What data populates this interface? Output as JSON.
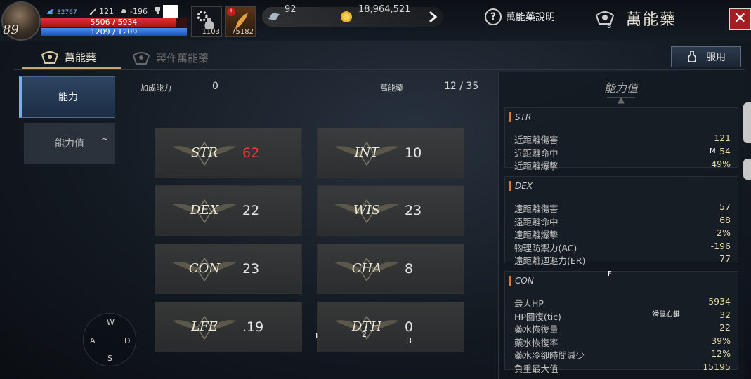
{
  "hud": {
    "level": "89",
    "exp": "32767",
    "attack": "121",
    "armor": "-196",
    "hp": "5506 / 5934",
    "hp_fraction": 0.928,
    "mp": "1209 / 1209",
    "mp_fraction": 1.0,
    "slot1_count": "1103",
    "slot2_count": "75182",
    "silver": "92",
    "gold": "18,964,521",
    "help_label": "萬能藥說明",
    "title": "萬能藥",
    "title_badge": "8",
    "close_label": "✕"
  },
  "tabs": [
    {
      "label": "萬能藥",
      "active": true
    },
    {
      "label": "製作萬能藥",
      "active": false
    }
  ],
  "use_button": "服用",
  "nav": {
    "items": [
      {
        "label": "能力"
      },
      {
        "label": "能力值"
      }
    ],
    "item2_marker": "~"
  },
  "compass": {
    "n": "W",
    "w": "A",
    "e": "D",
    "s": "S"
  },
  "summary": {
    "bonus_label": "加成能力",
    "bonus_value": "0",
    "potion_label": "萬能藥",
    "potion_value": "12 / 35"
  },
  "stats": [
    {
      "name": "STR",
      "value": "62"
    },
    {
      "name": "INT",
      "value": "10"
    },
    {
      "name": "DEX",
      "value": "22"
    },
    {
      "name": "WIS",
      "value": "23"
    },
    {
      "name": "CON",
      "value": "23"
    },
    {
      "name": "CHA",
      "value": "8"
    },
    {
      "name": "LFE",
      "value": ".19"
    },
    {
      "name": "DTH",
      "value": "0"
    }
  ],
  "markers": [
    "1",
    "2",
    "3"
  ],
  "panel": {
    "title": "能力值",
    "sections": [
      {
        "head": "STR",
        "rows": [
          {
            "k": "近距離傷害",
            "v": "121"
          },
          {
            "k": "近距離命中",
            "v": "54"
          },
          {
            "k": "近距離爆擊",
            "v": "49%"
          }
        ]
      },
      {
        "head": "DEX",
        "rows": [
          {
            "k": "遠距離傷害",
            "v": "57"
          },
          {
            "k": "遠距離命中",
            "v": "68"
          },
          {
            "k": "遠距離爆擊",
            "v": "2%"
          },
          {
            "k": "物理防禦力(AC)",
            "v": "-196"
          },
          {
            "k": "遠距離迴避力(ER)",
            "v": "77"
          }
        ]
      },
      {
        "head": "CON",
        "rows": [
          {
            "k": "最大HP",
            "v": "5934"
          },
          {
            "k": "HP回復(tic)",
            "v": "32"
          },
          {
            "k": "藥水恢復量",
            "v": "22"
          },
          {
            "k": "藥水恢復率",
            "v": "39%"
          },
          {
            "k": "藥水冷卻時間減少",
            "v": "12%"
          },
          {
            "k": "負重最大值",
            "v": "15195"
          }
        ]
      }
    ],
    "overlay_m": "M",
    "overlay_f": "F",
    "overlay_scroll": "滑鼠右鍵"
  },
  "colors": {
    "accent_gold": "#c8a770",
    "hp_red": "#e3323a",
    "mp_blue": "#4a8df0",
    "stat_highlight": "#ea3b3b",
    "close_red": "#a11e22"
  }
}
